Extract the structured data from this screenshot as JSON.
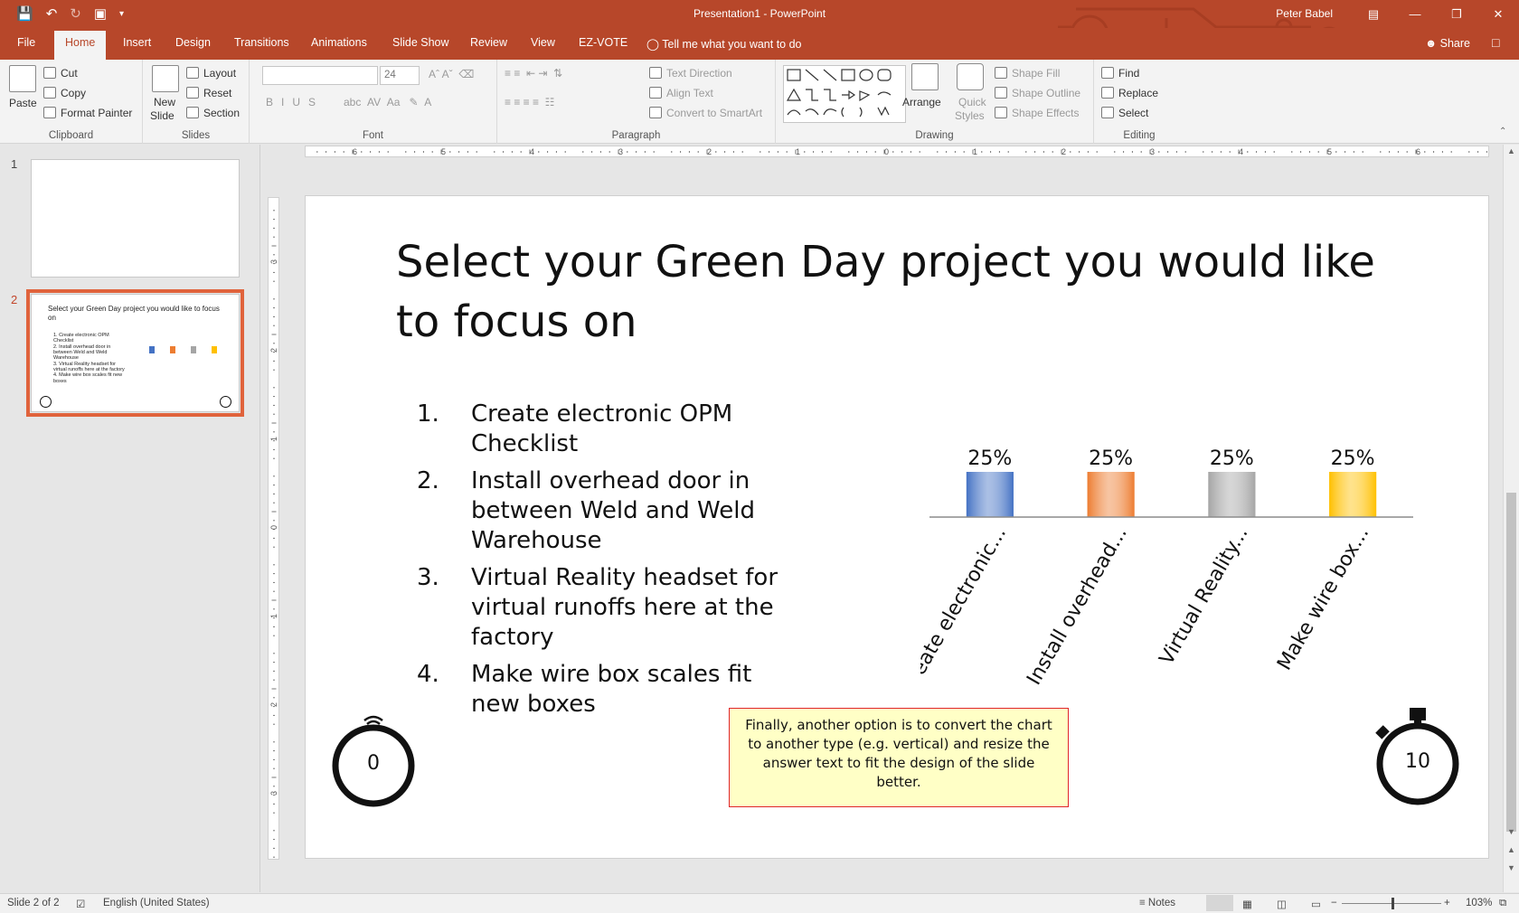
{
  "titlebar": {
    "title": "Presentation1  -  PowerPoint",
    "user": "Peter Babel",
    "qat": [
      "save-icon",
      "undo-icon",
      "redo-icon",
      "present-from-start-icon",
      "customize-qat-icon"
    ]
  },
  "tabs": [
    "File",
    "Home",
    "Insert",
    "Design",
    "Transitions",
    "Animations",
    "Slide Show",
    "Review",
    "View",
    "EZ-VOTE"
  ],
  "tell_me": "Tell me what you want to do",
  "share_label": "Share",
  "ribbon": {
    "clipboard": {
      "paste": "Paste",
      "cut": "Cut",
      "copy": "Copy",
      "format_painter": "Format Painter",
      "label": "Clipboard"
    },
    "slides": {
      "new_slide": "New",
      "new_slide_2": "Slide",
      "layout": "Layout",
      "reset": "Reset",
      "section": "Section",
      "label": "Slides"
    },
    "font": {
      "size": "24",
      "label": "Font",
      "buttons": [
        "B",
        "I",
        "U",
        "S",
        "abc",
        "AV",
        "Aa"
      ]
    },
    "paragraph": {
      "text_direction": "Text Direction",
      "align_text": "Align Text",
      "convert_smartart": "Convert to SmartArt",
      "label": "Paragraph"
    },
    "drawing": {
      "arrange": "Arrange",
      "quick_styles_1": "Quick",
      "quick_styles_2": "Styles",
      "shape_fill": "Shape Fill",
      "shape_outline": "Shape Outline",
      "shape_effects": "Shape Effects",
      "label": "Drawing"
    },
    "editing": {
      "find": "Find",
      "replace": "Replace",
      "select": "Select",
      "label": "Editing"
    }
  },
  "thumbnails": [
    {
      "number": "1"
    },
    {
      "number": "2",
      "title": "Select your Green Day project you would like to focus on"
    }
  ],
  "slide": {
    "title": "Select your Green Day project you would like to focus on",
    "items": [
      {
        "num": "1.",
        "text": "Create electronic OPM Checklist"
      },
      {
        "num": "2.",
        "text": "Install overhead door in between Weld and Weld Warehouse"
      },
      {
        "num": "3.",
        "text": "Virtual Reality headset for virtual runoffs here at the factory"
      },
      {
        "num": "4.",
        "text": "Make wire box scales fit new boxes"
      }
    ],
    "note": "Finally, another option is to convert the chart to another type (e.g. vertical) and resize the answer text to fit the design of the slide better.",
    "timer_left": "0",
    "timer_right": "10"
  },
  "chart_data": {
    "type": "bar",
    "categories": [
      "Create electronic...",
      "Install overhead...",
      "Virtual Reality...",
      "Make wire box..."
    ],
    "values": [
      25,
      25,
      25,
      25
    ],
    "data_labels": [
      "25%",
      "25%",
      "25%",
      "25%"
    ],
    "colors": [
      "#4472c4",
      "#ed7d31",
      "#a5a5a5",
      "#ffc000"
    ],
    "ylim": [
      0,
      100
    ],
    "xlabel": "",
    "ylabel": ""
  },
  "statusbar": {
    "slide_info": "Slide 2 of 2",
    "language": "English (United States)",
    "notes": "Notes",
    "zoom": "103%"
  },
  "colors": {
    "accent": "#b7472a",
    "selected_thumb": "#e0633c",
    "note_border": "#e0262b",
    "note_fill": "#ffffc6"
  }
}
